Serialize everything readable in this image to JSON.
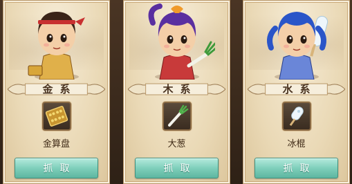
{
  "cards": [
    {
      "element": "金系",
      "item_name": "金算盘",
      "item_icon": "golden-abacus-icon",
      "hero": "boy-red-headband",
      "button_label": "抓取",
      "colors": {
        "hair": "#3a2418",
        "outfit": "#e0b04a"
      }
    },
    {
      "element": "木系",
      "item_name": "大葱",
      "item_icon": "green-onion-icon",
      "hero": "girl-purple-hair-orange-ribbon",
      "button_label": "抓取",
      "colors": {
        "hair": "#5a2fa0",
        "outfit": "#c83a3a"
      }
    },
    {
      "element": "水系",
      "item_name": "冰棍",
      "item_icon": "popsicle-icon",
      "hero": "girl-blue-twin-tails",
      "button_label": "抓取",
      "colors": {
        "hair": "#2a55c8",
        "outfit": "#6a86d8"
      }
    }
  ],
  "button_color": "#7fcfbb"
}
